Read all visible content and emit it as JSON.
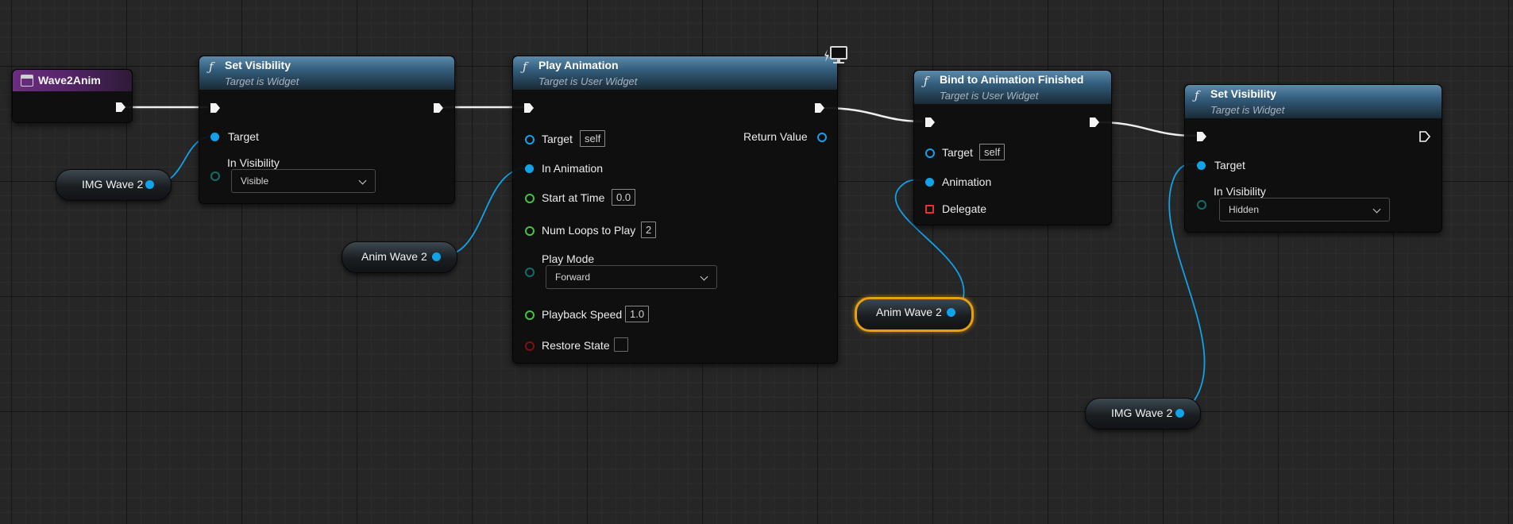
{
  "canvas": {
    "background": "#262626",
    "grid_major": "#151515",
    "grid_minor": "#2d2d2d"
  },
  "colors": {
    "exec_wire": "#f0f0f0",
    "object_pin": "#11a2e8",
    "float_pin": "#47c242",
    "byte_pin": "#0c6f6a",
    "bool_pin": "#7e1212",
    "delegate_pin": "#e83030",
    "selection": "#e8a010",
    "function_header": "#335d7c",
    "event_header": "#6c2d80"
  },
  "event_node": {
    "title": "Wave2Anim",
    "icon": "event-icon"
  },
  "set_visibility_1": {
    "fn_icon": "ƒ",
    "title": "Set Visibility",
    "subtitle": "Target is Widget",
    "target_label": "Target",
    "in_visibility_label": "In Visibility",
    "in_visibility_value": "Visible"
  },
  "play_animation": {
    "fn_icon": "ƒ",
    "title": "Play Animation",
    "subtitle": "Target is User Widget",
    "target_label": "Target",
    "target_value": "self",
    "return_label": "Return Value",
    "in_animation_label": "In Animation",
    "start_at_time_label": "Start at Time",
    "start_at_time_value": "0.0",
    "num_loops_label": "Num Loops to Play",
    "num_loops_value": "2",
    "play_mode_label": "Play Mode",
    "play_mode_value": "Forward",
    "playback_speed_label": "Playback Speed",
    "playback_speed_value": "1.0",
    "restore_state_label": "Restore State",
    "restore_state_checked": false,
    "badge_icon": "monitor-icon"
  },
  "bind_anim_finished": {
    "fn_icon": "ƒ",
    "title": "Bind to Animation Finished",
    "subtitle": "Target is User Widget",
    "target_label": "Target",
    "target_value": "self",
    "animation_label": "Animation",
    "delegate_label": "Delegate"
  },
  "set_visibility_2": {
    "fn_icon": "ƒ",
    "title": "Set Visibility",
    "subtitle": "Target is Widget",
    "target_label": "Target",
    "in_visibility_label": "In Visibility",
    "in_visibility_value": "Hidden"
  },
  "variables": {
    "img_wave_1": "IMG Wave 2",
    "anim_wave_1": "Anim Wave 2",
    "anim_wave_2": "Anim Wave 2",
    "img_wave_2": "IMG Wave 2"
  }
}
